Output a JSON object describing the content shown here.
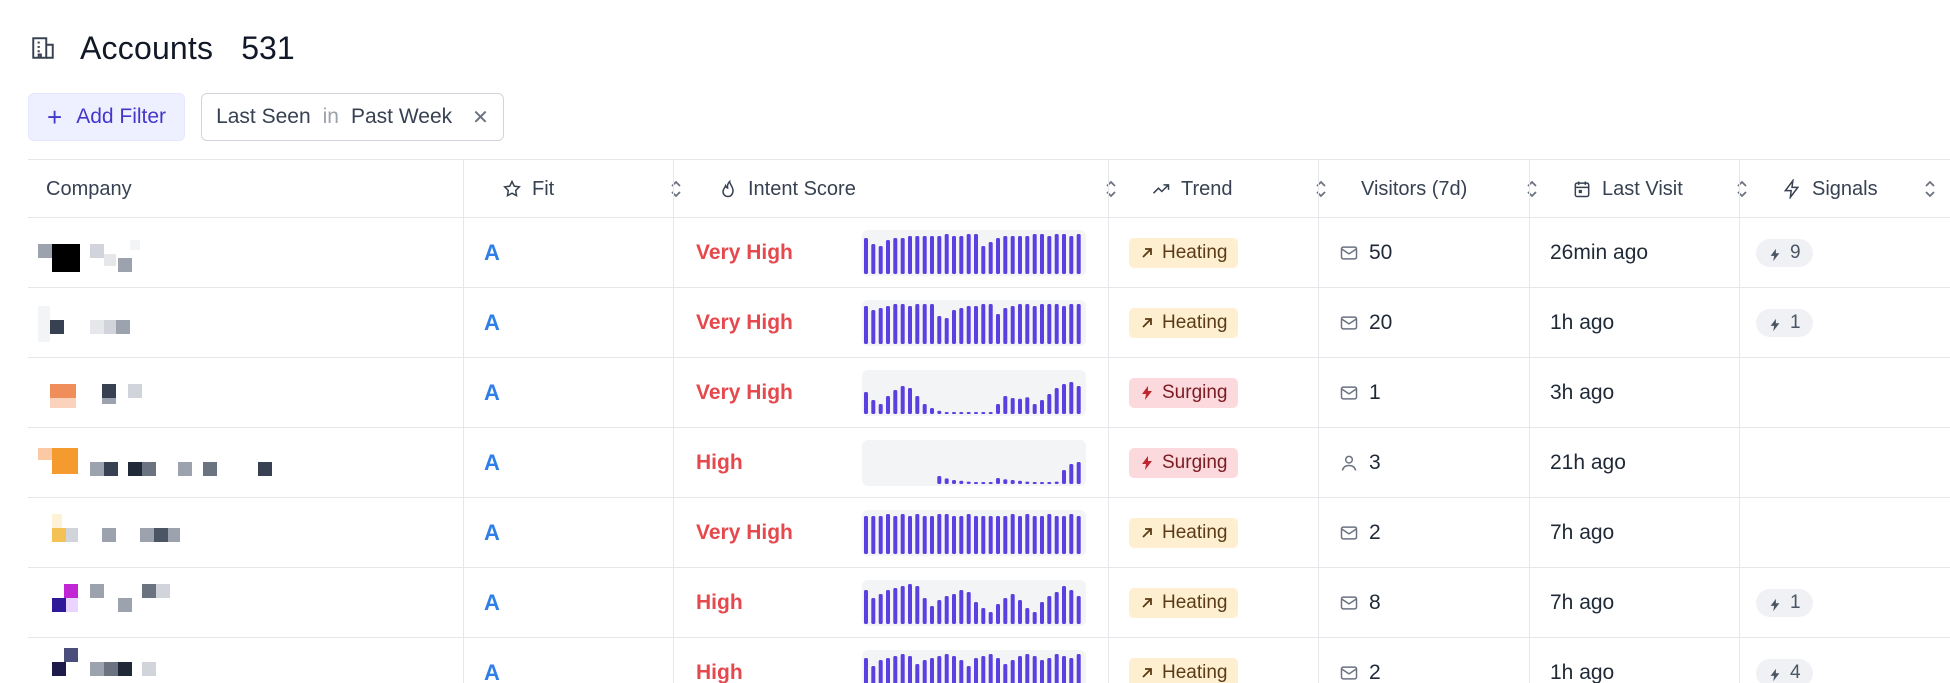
{
  "header": {
    "title": "Accounts",
    "count": "531",
    "icon": "building-icon"
  },
  "filters": {
    "add_label": "Add Filter",
    "chip": {
      "field": "Last Seen",
      "operator": "in",
      "value": "Past Week"
    }
  },
  "columns": {
    "company": "Company",
    "fit": "Fit",
    "intent": "Intent Score",
    "trend": "Trend",
    "visitors": "Visitors (7d)",
    "last_visit": "Last Visit",
    "signals": "Signals"
  },
  "colors": {
    "accent": "#4338ca",
    "bar": "#5b3fe0",
    "fit": "#2f7fe8",
    "intent": "#e5484d",
    "heating_bg": "#fdefd0",
    "surging_bg": "#fbd9dc"
  },
  "rows": [
    {
      "fit": "A",
      "intent": "Very High",
      "trend": "Heating",
      "trend_type": "heat",
      "visitor_icon": "mail-icon",
      "visitors": "50",
      "last_visit": "26min ago",
      "signals": "9",
      "spark": [
        0.9,
        0.75,
        0.7,
        0.85,
        0.9,
        0.9,
        0.95,
        0.95,
        0.95,
        0.95,
        0.95,
        1,
        0.95,
        0.95,
        1,
        1,
        0.7,
        0.8,
        0.9,
        0.95,
        0.95,
        0.95,
        0.95,
        1,
        1,
        0.95,
        1,
        1,
        0.95,
        1
      ]
    },
    {
      "fit": "A",
      "intent": "Very High",
      "trend": "Heating",
      "trend_type": "heat",
      "visitor_icon": "mail-icon",
      "visitors": "20",
      "last_visit": "1h ago",
      "signals": "1",
      "spark": [
        0.95,
        0.85,
        0.9,
        0.95,
        1,
        1,
        0.95,
        1,
        1,
        1,
        0.7,
        0.65,
        0.85,
        0.9,
        0.95,
        0.95,
        1,
        1,
        0.75,
        0.9,
        0.95,
        1,
        1,
        0.95,
        1,
        1,
        1,
        0.95,
        1,
        1
      ]
    },
    {
      "fit": "A",
      "intent": "Very High",
      "trend": "Surging",
      "trend_type": "surge",
      "visitor_icon": "mail-icon",
      "visitors": "1",
      "last_visit": "3h ago",
      "signals": "",
      "spark": [
        0.55,
        0.35,
        0.25,
        0.45,
        0.6,
        0.7,
        0.65,
        0.45,
        0.25,
        0.15,
        0.08,
        0.04,
        0.04,
        0.03,
        0.03,
        0.03,
        0.03,
        0.03,
        0.25,
        0.45,
        0.4,
        0.38,
        0.42,
        0.25,
        0.35,
        0.5,
        0.65,
        0.75,
        0.8,
        0.7
      ]
    },
    {
      "fit": "A",
      "intent": "High",
      "trend": "Surging",
      "trend_type": "surge",
      "visitor_icon": "person-icon",
      "visitors": "3",
      "last_visit": "21h ago",
      "signals": "",
      "spark": [
        0,
        0,
        0,
        0,
        0,
        0,
        0,
        0,
        0,
        0,
        0.2,
        0.14,
        0.1,
        0.08,
        0.06,
        0.05,
        0.04,
        0.03,
        0.15,
        0.12,
        0.1,
        0.08,
        0.06,
        0.05,
        0.05,
        0.04,
        0.06,
        0.35,
        0.5,
        0.55
      ]
    },
    {
      "fit": "A",
      "intent": "Very High",
      "trend": "Heating",
      "trend_type": "heat",
      "visitor_icon": "mail-icon",
      "visitors": "2",
      "last_visit": "7h ago",
      "signals": "",
      "spark": [
        0.95,
        0.95,
        0.95,
        1,
        0.95,
        1,
        0.95,
        1,
        0.95,
        0.95,
        1,
        1,
        0.95,
        0.95,
        1,
        0.95,
        0.95,
        0.95,
        0.95,
        0.95,
        1,
        0.95,
        1,
        0.95,
        0.95,
        1,
        0.95,
        0.95,
        1,
        0.95
      ]
    },
    {
      "fit": "A",
      "intent": "High",
      "trend": "Heating",
      "trend_type": "heat",
      "visitor_icon": "mail-icon",
      "visitors": "8",
      "last_visit": "7h ago",
      "signals": "1",
      "spark": [
        0.85,
        0.65,
        0.75,
        0.85,
        0.9,
        0.95,
        1,
        0.95,
        0.65,
        0.45,
        0.6,
        0.7,
        0.75,
        0.85,
        0.8,
        0.55,
        0.4,
        0.3,
        0.5,
        0.65,
        0.75,
        0.6,
        0.4,
        0.3,
        0.55,
        0.7,
        0.8,
        0.95,
        0.85,
        0.7
      ]
    },
    {
      "fit": "A",
      "intent": "High",
      "trend": "Heating",
      "trend_type": "heat",
      "visitor_icon": "mail-icon",
      "visitors": "2",
      "last_visit": "1h ago",
      "signals": "4",
      "spark": [
        0.9,
        0.7,
        0.85,
        0.9,
        0.95,
        1,
        0.95,
        0.75,
        0.85,
        0.9,
        0.95,
        1,
        0.95,
        0.85,
        0.7,
        0.9,
        0.95,
        1,
        0.9,
        0.75,
        0.85,
        0.95,
        1,
        0.95,
        0.85,
        0.9,
        1,
        0.95,
        0.9,
        1
      ]
    }
  ]
}
